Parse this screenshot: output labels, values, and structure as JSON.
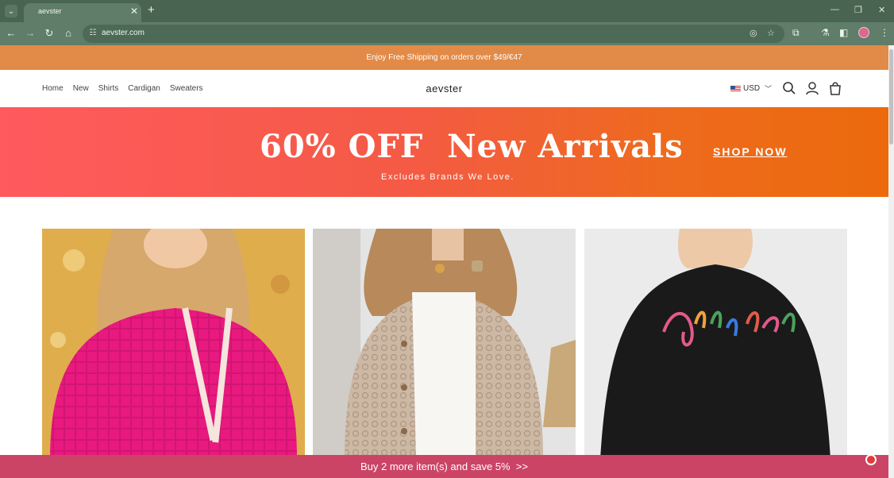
{
  "browser": {
    "tab_title": "aevster",
    "url": "aevster.com"
  },
  "announcement": "Enjoy Free Shipping on orders over $49/€47",
  "header": {
    "nav": [
      "Home",
      "New",
      "Shirts",
      "Cardigan",
      "Sweaters"
    ],
    "logo": "aevster",
    "currency": "USD"
  },
  "hero": {
    "title": "60% OFF  New Arrivals",
    "subtitle": "Excludes Brands We Love.",
    "cta": "SHOP NOW"
  },
  "products": [
    {
      "image": "pink-waffle-knit-hoodie"
    },
    {
      "image": "beige-crochet-cardigan"
    },
    {
      "image": "black-holly-jolly-sweater"
    }
  ],
  "cart_bar": "Buy 2 more item(s) and save 5%  >>",
  "colors": {
    "announcement_bg": "#e28a47",
    "hero_start": "#ff5a5e",
    "hero_end": "#ec6a0c",
    "cart_bar_bg": "#cb4466"
  }
}
